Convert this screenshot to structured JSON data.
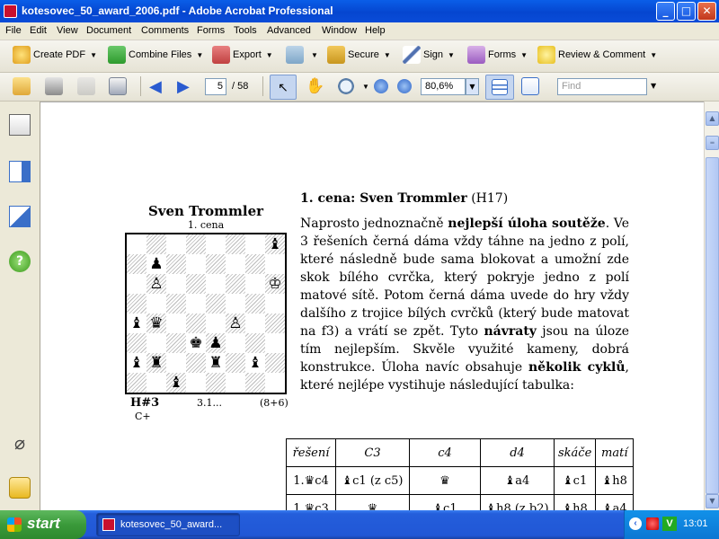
{
  "window": {
    "title": "kotesovec_50_award_2006.pdf - Adobe Acrobat Professional",
    "min": "_",
    "max": "□",
    "close": "✕"
  },
  "menu": [
    "File",
    "Edit",
    "View",
    "Document",
    "Comments",
    "Forms",
    "Tools",
    "Advanced",
    "Window",
    "Help"
  ],
  "toolbar1": {
    "create_pdf": "Create PDF",
    "combine_files": "Combine Files",
    "export": "Export",
    "secure": "Secure",
    "sign": "Sign",
    "forms": "Forms",
    "review": "Review & Comment"
  },
  "toolbar2": {
    "page_current": "5",
    "page_total": "/ 58",
    "zoom": "80,6%",
    "find_placeholder": "Find"
  },
  "diagram": {
    "author": "Sven Trommler",
    "award": "1. cena",
    "stipulation": "H#3",
    "extra": "C+",
    "solutions": "3.1...",
    "counts": "(8+6)",
    "rows": [
      [
        "",
        "",
        "",
        "",
        "",
        "",
        "",
        "♝"
      ],
      [
        "",
        "♟",
        "",
        "",
        "",
        "",
        "",
        ""
      ],
      [
        "",
        "♙",
        "",
        "",
        "",
        "",
        "",
        "♔"
      ],
      [
        "",
        "",
        "",
        "",
        "",
        "",
        "",
        ""
      ],
      [
        "♝",
        "♛",
        "",
        "",
        "",
        "♙",
        "",
        ""
      ],
      [
        "",
        "",
        "",
        "♚",
        "♟",
        "",
        "",
        ""
      ],
      [
        "♝",
        "♜",
        "",
        "",
        "♜",
        "",
        "♝",
        ""
      ],
      [
        "",
        "",
        "♝",
        "",
        "",
        "",
        "",
        ""
      ]
    ]
  },
  "article": {
    "heading_bold": "1. cena: Sven Trommler",
    "heading_normal": " (H17)",
    "p1": "Naprosto jednoznačně ",
    "b1": "nejlepší úloha soutěže",
    "p2": ". Ve 3 řešeních černá dáma vždy táhne na jedno z polí, které následně bude sama blokovat a umožní zde skok bílého cvrčka, který pokryje jedno z polí matové sítě. Potom černá dáma uvede do hry vždy dalšího z trojice bílých cvrčků (který bude matovat na f3) a vrátí se zpět. Tyto ",
    "b2": "návraty",
    "p3": " jsou na úloze tím nejlepším. Skvěle využité kameny, dobrá konstrukce. Úloha navíc obsahuje ",
    "b3": "několik cyklů",
    "p4": ", které nejlépe vystihuje následující tabulka:"
  },
  "table": {
    "headers": [
      "řešení",
      "C3",
      "c4",
      "d4",
      "skáče",
      "matí"
    ],
    "rows": [
      [
        "1.♛c4",
        "♝c1 (z c5)",
        "♛",
        "♝a4",
        "♝c1",
        "♝h8"
      ],
      [
        "1.♛c3",
        "♛",
        "♝c1",
        "♝h8 (z b2)",
        "♝h8",
        "♝a4"
      ]
    ]
  },
  "taskbar": {
    "start": "start",
    "task": "kotesovec_50_award...",
    "clock": "13:01"
  },
  "colors": {
    "titlebar": "#0546d0",
    "taskbar": "#245edb",
    "start": "#3a9a3a"
  }
}
